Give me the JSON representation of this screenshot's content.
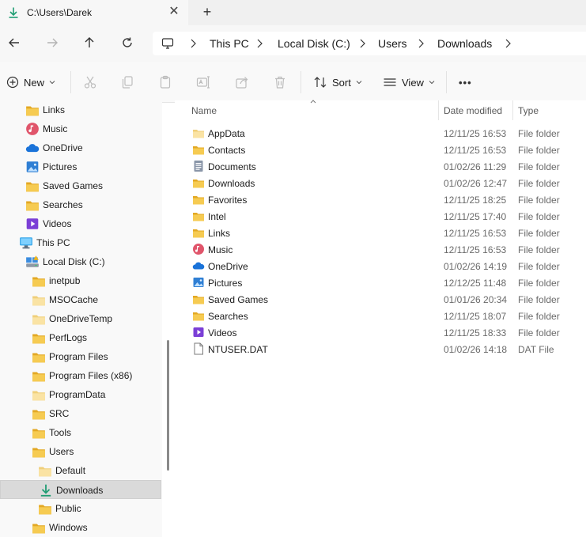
{
  "tab": {
    "title": "C:\\Users\\Darek",
    "close": "✕",
    "new_tab": "+"
  },
  "breadcrumb": [
    "This PC",
    "Local Disk (C:)",
    "Users",
    "Downloads"
  ],
  "commands": {
    "new": "New",
    "sort": "Sort",
    "view": "View",
    "more": "•••"
  },
  "columns": {
    "name": "Name",
    "date": "Date modified",
    "type": "Type"
  },
  "sidebar": [
    {
      "label": "Links",
      "icon": "folder"
    },
    {
      "label": "Music",
      "icon": "music"
    },
    {
      "label": "OneDrive",
      "icon": "onedrive"
    },
    {
      "label": "Pictures",
      "icon": "pictures"
    },
    {
      "label": "Saved Games",
      "icon": "folder"
    },
    {
      "label": "Searches",
      "icon": "folder"
    },
    {
      "label": "Videos",
      "icon": "videos"
    },
    {
      "label": "This PC",
      "icon": "pc"
    },
    {
      "label": "Local Disk (C:)",
      "icon": "drive"
    },
    {
      "label": "inetpub",
      "icon": "folder"
    },
    {
      "label": "MSOCache",
      "icon": "folder-light"
    },
    {
      "label": "OneDriveTemp",
      "icon": "folder-light"
    },
    {
      "label": "PerfLogs",
      "icon": "folder"
    },
    {
      "label": "Program Files",
      "icon": "folder"
    },
    {
      "label": "Program Files (x86)",
      "icon": "folder"
    },
    {
      "label": "ProgramData",
      "icon": "folder-light"
    },
    {
      "label": "SRC",
      "icon": "folder"
    },
    {
      "label": "Tools",
      "icon": "folder"
    },
    {
      "label": "Users",
      "icon": "folder"
    },
    {
      "label": "Default",
      "icon": "folder-light"
    },
    {
      "label": "Downloads",
      "icon": "download",
      "selected": true
    },
    {
      "label": "Public",
      "icon": "folder"
    },
    {
      "label": "Windows",
      "icon": "folder"
    }
  ],
  "files": [
    {
      "name": "AppData",
      "date": "12/11/25 16:53",
      "type": "File folder",
      "icon": "folder-light"
    },
    {
      "name": "Contacts",
      "date": "12/11/25 16:53",
      "type": "File folder",
      "icon": "folder"
    },
    {
      "name": "Documents",
      "date": "01/02/26 11:29",
      "type": "File folder",
      "icon": "documents"
    },
    {
      "name": "Downloads",
      "date": "01/02/26 12:47",
      "type": "File folder",
      "icon": "folder"
    },
    {
      "name": "Favorites",
      "date": "12/11/25 18:25",
      "type": "File folder",
      "icon": "folder"
    },
    {
      "name": "Intel",
      "date": "12/11/25 17:40",
      "type": "File folder",
      "icon": "folder"
    },
    {
      "name": "Links",
      "date": "12/11/25 16:53",
      "type": "File folder",
      "icon": "folder"
    },
    {
      "name": "Music",
      "date": "12/11/25 16:53",
      "type": "File folder",
      "icon": "music"
    },
    {
      "name": "OneDrive",
      "date": "01/02/26 14:19",
      "type": "File folder",
      "icon": "onedrive"
    },
    {
      "name": "Pictures",
      "date": "12/12/25 11:48",
      "type": "File folder",
      "icon": "pictures"
    },
    {
      "name": "Saved Games",
      "date": "01/01/26 20:34",
      "type": "File folder",
      "icon": "folder"
    },
    {
      "name": "Searches",
      "date": "12/11/25 18:07",
      "type": "File folder",
      "icon": "folder"
    },
    {
      "name": "Videos",
      "date": "12/11/25 18:33",
      "type": "File folder",
      "icon": "videos"
    },
    {
      "name": "NTUSER.DAT",
      "date": "01/02/26 14:18",
      "type": "DAT File",
      "icon": "file"
    }
  ],
  "colors": {
    "folder": "#f4c84a",
    "folder_dark": "#e3a823",
    "accent": "#1f9d73",
    "onedrive": "#1a73d9"
  }
}
